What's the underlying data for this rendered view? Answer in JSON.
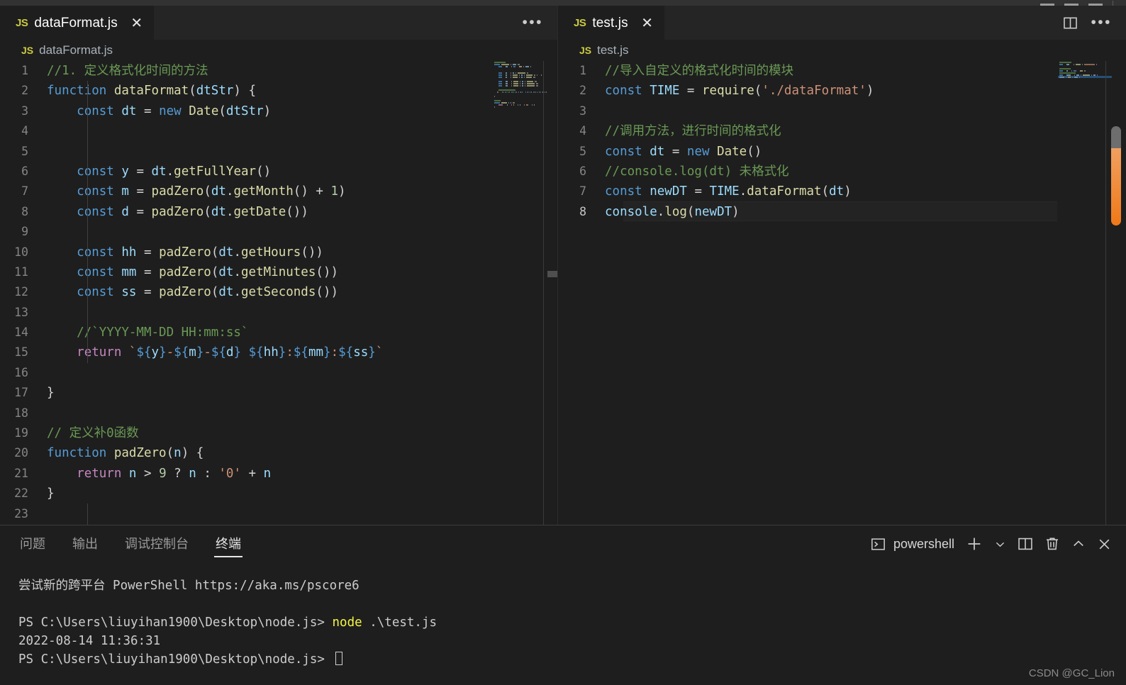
{
  "window": {
    "controls": [
      "minimize",
      "maximize",
      "close"
    ]
  },
  "editor_groups": [
    {
      "id": "left",
      "tab": {
        "label": "dataFormat.js",
        "file_icon": "js-icon",
        "close_icon": "close-icon",
        "active": true
      },
      "actions": {
        "more_icon": "ellipsis-icon"
      },
      "breadcrumb": {
        "icon": "js-icon",
        "label": "dataFormat.js"
      },
      "lines": [
        {
          "n": "1",
          "tokens": [
            {
              "t": "//1. 定义格式化时间的方法",
              "c": "c-cmt"
            }
          ]
        },
        {
          "n": "2",
          "tokens": [
            {
              "t": "function ",
              "c": "c-kw"
            },
            {
              "t": "dataFormat",
              "c": "c-fn"
            },
            {
              "t": "(",
              "c": "c-punc"
            },
            {
              "t": "dtStr",
              "c": "c-var"
            },
            {
              "t": ") {",
              "c": "c-punc"
            }
          ]
        },
        {
          "n": "3",
          "tokens": [
            {
              "t": "    ",
              "c": "c-punc"
            },
            {
              "t": "const",
              "c": "c-kw"
            },
            {
              "t": " ",
              "c": "c-punc"
            },
            {
              "t": "dt",
              "c": "c-var"
            },
            {
              "t": " = ",
              "c": "c-op"
            },
            {
              "t": "new",
              "c": "c-kw"
            },
            {
              "t": " ",
              "c": "c-punc"
            },
            {
              "t": "Date",
              "c": "c-fn"
            },
            {
              "t": "(",
              "c": "c-punc"
            },
            {
              "t": "dtStr",
              "c": "c-var"
            },
            {
              "t": ")",
              "c": "c-punc"
            }
          ]
        },
        {
          "n": "4",
          "tokens": []
        },
        {
          "n": "5",
          "tokens": []
        },
        {
          "n": "6",
          "tokens": [
            {
              "t": "    ",
              "c": "c-punc"
            },
            {
              "t": "const",
              "c": "c-kw"
            },
            {
              "t": " ",
              "c": "c-punc"
            },
            {
              "t": "y",
              "c": "c-var"
            },
            {
              "t": " = ",
              "c": "c-op"
            },
            {
              "t": "dt",
              "c": "c-var"
            },
            {
              "t": ".",
              "c": "c-punc"
            },
            {
              "t": "getFullYear",
              "c": "c-fn"
            },
            {
              "t": "()",
              "c": "c-punc"
            }
          ]
        },
        {
          "n": "7",
          "tokens": [
            {
              "t": "    ",
              "c": "c-punc"
            },
            {
              "t": "const",
              "c": "c-kw"
            },
            {
              "t": " ",
              "c": "c-punc"
            },
            {
              "t": "m",
              "c": "c-var"
            },
            {
              "t": " = ",
              "c": "c-op"
            },
            {
              "t": "padZero",
              "c": "c-fn"
            },
            {
              "t": "(",
              "c": "c-punc"
            },
            {
              "t": "dt",
              "c": "c-var"
            },
            {
              "t": ".",
              "c": "c-punc"
            },
            {
              "t": "getMonth",
              "c": "c-fn"
            },
            {
              "t": "() ",
              "c": "c-punc"
            },
            {
              "t": "+",
              "c": "c-op"
            },
            {
              "t": " ",
              "c": "c-punc"
            },
            {
              "t": "1",
              "c": "c-num"
            },
            {
              "t": ")",
              "c": "c-punc"
            }
          ]
        },
        {
          "n": "8",
          "tokens": [
            {
              "t": "    ",
              "c": "c-punc"
            },
            {
              "t": "const",
              "c": "c-kw"
            },
            {
              "t": " ",
              "c": "c-punc"
            },
            {
              "t": "d",
              "c": "c-var"
            },
            {
              "t": " = ",
              "c": "c-op"
            },
            {
              "t": "padZero",
              "c": "c-fn"
            },
            {
              "t": "(",
              "c": "c-punc"
            },
            {
              "t": "dt",
              "c": "c-var"
            },
            {
              "t": ".",
              "c": "c-punc"
            },
            {
              "t": "getDate",
              "c": "c-fn"
            },
            {
              "t": "())",
              "c": "c-punc"
            }
          ]
        },
        {
          "n": "9",
          "tokens": []
        },
        {
          "n": "10",
          "tokens": [
            {
              "t": "    ",
              "c": "c-punc"
            },
            {
              "t": "const",
              "c": "c-kw"
            },
            {
              "t": " ",
              "c": "c-punc"
            },
            {
              "t": "hh",
              "c": "c-var"
            },
            {
              "t": " = ",
              "c": "c-op"
            },
            {
              "t": "padZero",
              "c": "c-fn"
            },
            {
              "t": "(",
              "c": "c-punc"
            },
            {
              "t": "dt",
              "c": "c-var"
            },
            {
              "t": ".",
              "c": "c-punc"
            },
            {
              "t": "getHours",
              "c": "c-fn"
            },
            {
              "t": "())",
              "c": "c-punc"
            }
          ]
        },
        {
          "n": "11",
          "tokens": [
            {
              "t": "    ",
              "c": "c-punc"
            },
            {
              "t": "const",
              "c": "c-kw"
            },
            {
              "t": " ",
              "c": "c-punc"
            },
            {
              "t": "mm",
              "c": "c-var"
            },
            {
              "t": " = ",
              "c": "c-op"
            },
            {
              "t": "padZero",
              "c": "c-fn"
            },
            {
              "t": "(",
              "c": "c-punc"
            },
            {
              "t": "dt",
              "c": "c-var"
            },
            {
              "t": ".",
              "c": "c-punc"
            },
            {
              "t": "getMinutes",
              "c": "c-fn"
            },
            {
              "t": "())",
              "c": "c-punc"
            }
          ]
        },
        {
          "n": "12",
          "tokens": [
            {
              "t": "    ",
              "c": "c-punc"
            },
            {
              "t": "const",
              "c": "c-kw"
            },
            {
              "t": " ",
              "c": "c-punc"
            },
            {
              "t": "ss",
              "c": "c-var"
            },
            {
              "t": " = ",
              "c": "c-op"
            },
            {
              "t": "padZero",
              "c": "c-fn"
            },
            {
              "t": "(",
              "c": "c-punc"
            },
            {
              "t": "dt",
              "c": "c-var"
            },
            {
              "t": ".",
              "c": "c-punc"
            },
            {
              "t": "getSeconds",
              "c": "c-fn"
            },
            {
              "t": "())",
              "c": "c-punc"
            }
          ]
        },
        {
          "n": "13",
          "tokens": []
        },
        {
          "n": "14",
          "tokens": [
            {
              "t": "    //`YYYY-MM-DD HH:mm:ss`",
              "c": "c-cmt"
            }
          ]
        },
        {
          "n": "15",
          "tokens": [
            {
              "t": "    ",
              "c": "c-punc"
            },
            {
              "t": "return",
              "c": "c-ctl"
            },
            {
              "t": " ",
              "c": "c-punc"
            },
            {
              "t": "`",
              "c": "c-tick"
            },
            {
              "t": "${",
              "c": "c-tpl"
            },
            {
              "t": "y",
              "c": "c-var"
            },
            {
              "t": "}",
              "c": "c-tpl"
            },
            {
              "t": "-",
              "c": "c-str"
            },
            {
              "t": "${",
              "c": "c-tpl"
            },
            {
              "t": "m",
              "c": "c-var"
            },
            {
              "t": "}",
              "c": "c-tpl"
            },
            {
              "t": "-",
              "c": "c-str"
            },
            {
              "t": "${",
              "c": "c-tpl"
            },
            {
              "t": "d",
              "c": "c-var"
            },
            {
              "t": "}",
              "c": "c-tpl"
            },
            {
              "t": " ",
              "c": "c-str"
            },
            {
              "t": "${",
              "c": "c-tpl"
            },
            {
              "t": "hh",
              "c": "c-var"
            },
            {
              "t": "}",
              "c": "c-tpl"
            },
            {
              "t": ":",
              "c": "c-str"
            },
            {
              "t": "${",
              "c": "c-tpl"
            },
            {
              "t": "mm",
              "c": "c-var"
            },
            {
              "t": "}",
              "c": "c-tpl"
            },
            {
              "t": ":",
              "c": "c-str"
            },
            {
              "t": "${",
              "c": "c-tpl"
            },
            {
              "t": "ss",
              "c": "c-var"
            },
            {
              "t": "}",
              "c": "c-tpl"
            },
            {
              "t": "`",
              "c": "c-tick"
            }
          ]
        },
        {
          "n": "16",
          "tokens": []
        },
        {
          "n": "17",
          "tokens": [
            {
              "t": "}",
              "c": "c-punc"
            }
          ]
        },
        {
          "n": "18",
          "tokens": []
        },
        {
          "n": "19",
          "tokens": [
            {
              "t": "// 定义补0函数",
              "c": "c-cmt"
            }
          ]
        },
        {
          "n": "20",
          "tokens": [
            {
              "t": "function ",
              "c": "c-kw"
            },
            {
              "t": "padZero",
              "c": "c-fn"
            },
            {
              "t": "(",
              "c": "c-punc"
            },
            {
              "t": "n",
              "c": "c-var"
            },
            {
              "t": ") {",
              "c": "c-punc"
            }
          ]
        },
        {
          "n": "21",
          "tokens": [
            {
              "t": "    ",
              "c": "c-punc"
            },
            {
              "t": "return",
              "c": "c-ctl"
            },
            {
              "t": " ",
              "c": "c-punc"
            },
            {
              "t": "n",
              "c": "c-var"
            },
            {
              "t": " > ",
              "c": "c-op"
            },
            {
              "t": "9",
              "c": "c-num"
            },
            {
              "t": " ? ",
              "c": "c-op"
            },
            {
              "t": "n",
              "c": "c-var"
            },
            {
              "t": " : ",
              "c": "c-op"
            },
            {
              "t": "'0'",
              "c": "c-str"
            },
            {
              "t": " + ",
              "c": "c-op"
            },
            {
              "t": "n",
              "c": "c-var"
            }
          ]
        },
        {
          "n": "22",
          "tokens": [
            {
              "t": "}",
              "c": "c-punc"
            }
          ]
        },
        {
          "n": "23",
          "tokens": []
        }
      ]
    },
    {
      "id": "right",
      "tab": {
        "label": "test.js",
        "file_icon": "js-icon",
        "close_icon": "close-icon",
        "active": true
      },
      "actions": {
        "split_icon": "split-editor-icon",
        "more_icon": "ellipsis-icon"
      },
      "breadcrumb": {
        "icon": "js-icon",
        "label": "test.js"
      },
      "lines": [
        {
          "n": "1",
          "tokens": [
            {
              "t": "//导入自定义的格式化时间的模块",
              "c": "c-cmt"
            }
          ]
        },
        {
          "n": "2",
          "tokens": [
            {
              "t": "const",
              "c": "c-kw"
            },
            {
              "t": " ",
              "c": "c-punc"
            },
            {
              "t": "TIME",
              "c": "c-var"
            },
            {
              "t": " = ",
              "c": "c-op"
            },
            {
              "t": "require",
              "c": "c-fn"
            },
            {
              "t": "(",
              "c": "c-punc"
            },
            {
              "t": "'./dataFormat'",
              "c": "c-str"
            },
            {
              "t": ")",
              "c": "c-punc"
            }
          ]
        },
        {
          "n": "3",
          "tokens": []
        },
        {
          "n": "4",
          "tokens": [
            {
              "t": "//调用方法，进行时间的格式化",
              "c": "c-cmt"
            }
          ]
        },
        {
          "n": "5",
          "tokens": [
            {
              "t": "const",
              "c": "c-kw"
            },
            {
              "t": " ",
              "c": "c-punc"
            },
            {
              "t": "dt",
              "c": "c-var"
            },
            {
              "t": " = ",
              "c": "c-op"
            },
            {
              "t": "new",
              "c": "c-kw"
            },
            {
              "t": " ",
              "c": "c-punc"
            },
            {
              "t": "Date",
              "c": "c-fn"
            },
            {
              "t": "()",
              "c": "c-punc"
            }
          ]
        },
        {
          "n": "6",
          "tokens": [
            {
              "t": "//console.log(dt) 未格式化",
              "c": "c-cmt"
            }
          ]
        },
        {
          "n": "7",
          "tokens": [
            {
              "t": "const",
              "c": "c-kw"
            },
            {
              "t": " ",
              "c": "c-punc"
            },
            {
              "t": "newDT",
              "c": "c-var"
            },
            {
              "t": " = ",
              "c": "c-op"
            },
            {
              "t": "TIME",
              "c": "c-var"
            },
            {
              "t": ".",
              "c": "c-punc"
            },
            {
              "t": "dataFormat",
              "c": "c-fn"
            },
            {
              "t": "(",
              "c": "c-punc"
            },
            {
              "t": "dt",
              "c": "c-var"
            },
            {
              "t": ")",
              "c": "c-punc"
            }
          ]
        },
        {
          "n": "8",
          "cursor": true,
          "tokens": [
            {
              "t": "console",
              "c": "c-var"
            },
            {
              "t": ".",
              "c": "c-punc"
            },
            {
              "t": "log",
              "c": "c-fn"
            },
            {
              "t": "(",
              "c": "c-punc"
            },
            {
              "t": "newDT",
              "c": "c-var"
            },
            {
              "t": ")",
              "c": "c-punc"
            }
          ]
        }
      ]
    }
  ],
  "panel": {
    "tabs": [
      {
        "label": "问题",
        "active": false
      },
      {
        "label": "输出",
        "active": false
      },
      {
        "label": "调试控制台",
        "active": false
      },
      {
        "label": "终端",
        "active": true
      }
    ],
    "terminal_name": "powershell",
    "actions": {
      "terminal_icon": "terminal-icon",
      "new_icon": "plus-icon",
      "dropdown_icon": "chevron-down-icon",
      "split_icon": "split-terminal-icon",
      "kill_icon": "trash-icon",
      "maximize_icon": "chevron-up-icon",
      "close_icon": "close-icon"
    },
    "terminal_lines": [
      {
        "segments": [
          {
            "t": "尝试新的跨平台 PowerShell https://aka.ms/pscore6",
            "c": "t-dim"
          }
        ]
      },
      {
        "segments": []
      },
      {
        "segments": [
          {
            "t": "PS C:\\Users\\liuyihan1900\\Desktop\\node.js> ",
            "c": "t-dim"
          },
          {
            "t": "node",
            "c": "t-yellow"
          },
          {
            "t": " .\\test.js",
            "c": "t-dim"
          }
        ]
      },
      {
        "segments": [
          {
            "t": "2022-08-14 11:36:31",
            "c": "t-dim"
          }
        ]
      },
      {
        "segments": [
          {
            "t": "PS C:\\Users\\liuyihan1900\\Desktop\\node.js> ",
            "c": "t-dim"
          }
        ],
        "cursor": true
      }
    ]
  },
  "watermark": "CSDN @GC_Lion"
}
